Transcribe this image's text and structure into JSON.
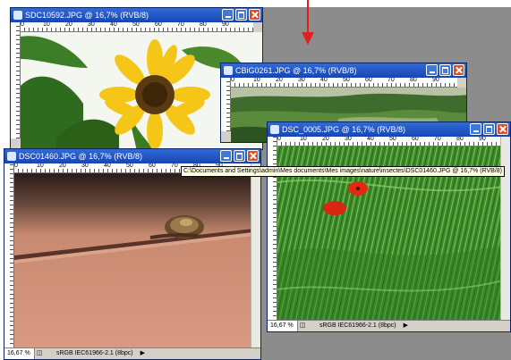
{
  "windows": {
    "sunflower": {
      "title": "SDC10592.JPG @ 16,7% (RVB/8)",
      "ruler": [
        "0",
        "10",
        "20",
        "30",
        "40",
        "50",
        "60",
        "70",
        "80",
        "90"
      ]
    },
    "landscape": {
      "title": "CBiG0261.JPG @ 16,7% (RVB/8)",
      "ruler": [
        "0",
        "10",
        "20",
        "30",
        "40",
        "50",
        "60",
        "70",
        "80",
        "90"
      ]
    },
    "poppies": {
      "title": "DSC_0005.JPG @ 16,7% (RVB/8)",
      "ruler": [
        "0",
        "10",
        "20",
        "30",
        "40",
        "50",
        "60",
        "70",
        "80",
        "90"
      ],
      "zoom": "16,67 %",
      "profile": "sRGB IEC61966-2.1 (8bpc)"
    },
    "snail": {
      "title": "DSC01460.JPG @ 16,7% (RVB/8)",
      "ruler": [
        "0",
        "10",
        "20",
        "30",
        "40",
        "50",
        "60",
        "70",
        "80",
        "90"
      ],
      "zoom": "16,67 %",
      "profile": "sRGB IEC61966-2.1 (8bpc)"
    }
  },
  "tooltip": "C:\\Documents and Settings\\admin\\Mes documents\\Mes images\\nature\\insectes\\DSC01460.JPG @ 16,7% (RVB/8)",
  "colors": {
    "titlebar": "#1f55c8",
    "close": "#e04b2a",
    "workspace_gray": "#8c8c8c",
    "arrow": "#e02020"
  },
  "icons": {
    "window_app": "photoshop-doc-icon",
    "minimize": "minimize-icon",
    "maximize": "maximize-icon",
    "close": "close-icon",
    "navigator": "navigator-icon",
    "arrow": "arrow-down-icon"
  }
}
